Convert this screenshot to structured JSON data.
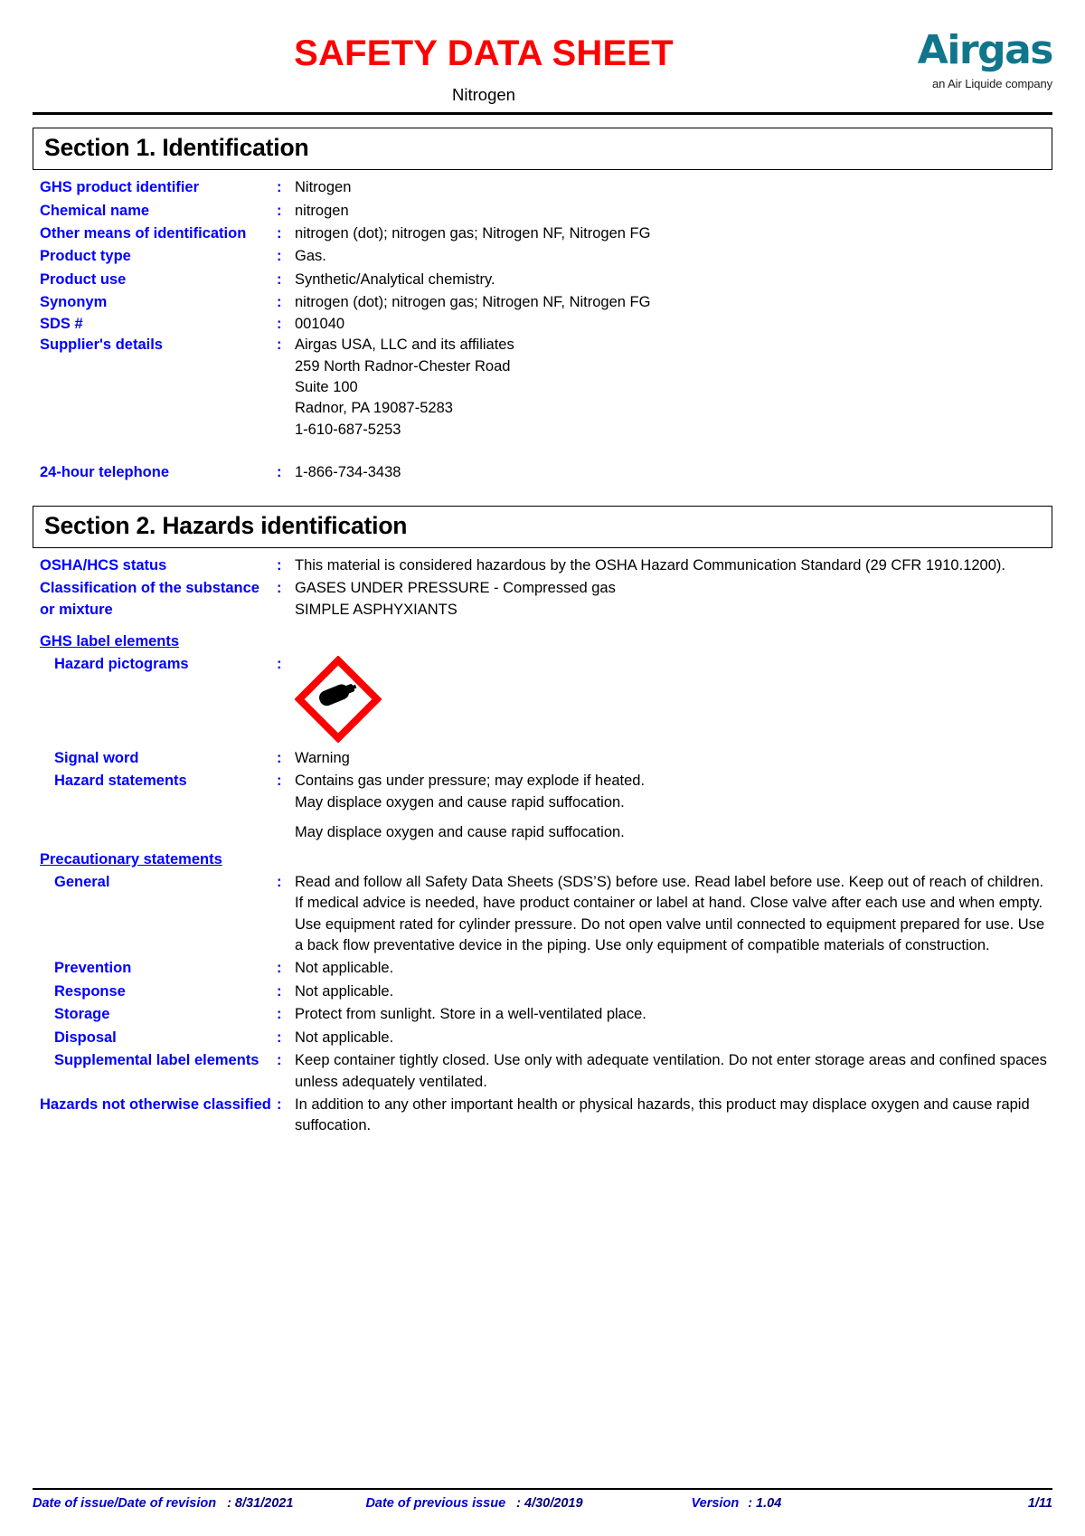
{
  "header": {
    "title": "SAFETY DATA SHEET",
    "subtitle": "Nitrogen",
    "logo_name": "Airgas",
    "logo_tagline": "an Air Liquide company",
    "brand_color": "#11768c",
    "title_color": "#ff0000"
  },
  "section1": {
    "heading": "Section 1. Identification",
    "fields": [
      {
        "label": "GHS product identifier",
        "colon": ":",
        "value": "Nitrogen"
      },
      {
        "label": "Chemical name",
        "colon": ":",
        "value": "nitrogen"
      },
      {
        "label": "Other means of identification",
        "colon": ":",
        "value": "nitrogen (dot); nitrogen gas; Nitrogen NF, Nitrogen FG"
      },
      {
        "label": "Product type",
        "colon": ":",
        "value": "Gas."
      },
      {
        "label": "Product use",
        "colon": ":",
        "value": "Synthetic/Analytical chemistry."
      },
      {
        "label": "Synonym",
        "colon": ":",
        "value": "nitrogen (dot); nitrogen gas; Nitrogen NF, Nitrogen FG"
      },
      {
        "label": "SDS #",
        "colon": ":",
        "value": "001040"
      }
    ],
    "supplier_label": "Supplier's details",
    "supplier_colon": ":",
    "supplier_lines": [
      "Airgas USA, LLC and its affiliates",
      "259 North Radnor-Chester Road",
      "Suite 100",
      "Radnor, PA 19087-5283",
      "1-610-687-5253"
    ],
    "phone_label": "24-hour telephone",
    "phone_colon": ":",
    "phone_value": "1-866-734-3438"
  },
  "section2": {
    "heading": "Section 2. Hazards identification",
    "osha_label": "OSHA/HCS status",
    "osha_colon": ":",
    "osha_value": "This material is considered hazardous by the OSHA Hazard Communication Standard (29 CFR 1910.1200).",
    "classification_label": "Classification of the substance or mixture",
    "classification_colon": ":",
    "classification_lines": [
      "GASES UNDER PRESSURE - Compressed gas",
      "SIMPLE ASPHYXIANTS"
    ],
    "ghs_label_elements_heading": "GHS label elements",
    "pictograms_label": "Hazard pictograms",
    "pictograms_colon": ":",
    "pictogram_icon": "gas-cylinder-pictogram",
    "pictogram_border_color": "#ff0000",
    "signal_word_label": "Signal word",
    "signal_word_colon": ":",
    "signal_word_value": "Warning",
    "hazard_statements_label": "Hazard statements",
    "hazard_statements_colon": ":",
    "hazard_statements_lines": [
      "Contains gas under pressure; may explode if heated.",
      "May displace oxygen and cause rapid suffocation."
    ],
    "hazard_statements_extra": "May displace oxygen and cause rapid suffocation.",
    "precautionary_heading": "Precautionary statements",
    "precautionary": [
      {
        "label": "General",
        "colon": ":",
        "value": "Read and follow all Safety Data Sheets (SDS’S) before use.  Read label before use.  Keep out of reach of children.  If medical advice is needed, have product container or label at hand.  Close valve after each use and when empty.  Use equipment rated for cylinder pressure.  Do not open valve until connected to equipment prepared for use.  Use a back flow preventative device in the piping.  Use only equipment of compatible materials of construction."
      },
      {
        "label": "Prevention",
        "colon": ":",
        "value": "Not applicable."
      },
      {
        "label": "Response",
        "colon": ":",
        "value": "Not applicable."
      },
      {
        "label": "Storage",
        "colon": ":",
        "value": "Protect from sunlight. Store in a well-ventilated place."
      },
      {
        "label": "Disposal",
        "colon": ":",
        "value": "Not applicable."
      }
    ],
    "supplemental_label": "Supplemental label elements",
    "supplemental_colon": ":",
    "supplemental_value": "Keep container tightly closed.  Use only with adequate ventilation.  Do not enter storage areas and confined spaces unless adequately ventilated.",
    "hnoc_label": "Hazards not otherwise classified",
    "hnoc_colon": ":",
    "hnoc_value": "In addition to any other important health or physical hazards, this product may displace oxygen and cause rapid suffocation."
  },
  "footer": {
    "issue_label": "Date of issue/Date of revision",
    "issue_value": ": 8/31/2021",
    "previous_label": "Date of previous issue",
    "previous_value": ": 4/30/2019",
    "version_label": "Version",
    "version_value": ": 1.04",
    "page": "1/11"
  }
}
